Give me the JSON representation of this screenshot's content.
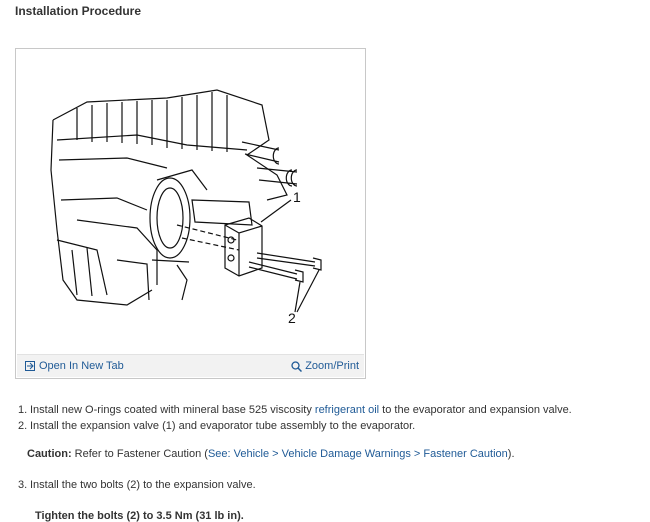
{
  "heading": "Installation Procedure",
  "figure": {
    "callout_1": "1",
    "callout_2": "2",
    "open_tab_label": "Open In New Tab",
    "zoom_label": "Zoom/Print"
  },
  "steps": [
    {
      "num": "1.",
      "pre": "Install new O-rings coated with mineral base 525 viscosity ",
      "link": "refrigerant oil",
      "post": " to the evaporator and expansion valve."
    },
    {
      "num": "2.",
      "text": "Install the expansion valve (1) and evaporator tube assembly to the evaporator."
    }
  ],
  "caution": {
    "label": "Caution:",
    "text": " Refer to Fastener Caution (",
    "link": "See: Vehicle > Vehicle Damage Warnings > Fastener Caution",
    "post": ")."
  },
  "step3": {
    "num": "3.",
    "text": "Install the two bolts (2) to the expansion valve."
  },
  "torque": "Tighten the bolts (2) to 3.5 Nm (31 lb in).",
  "colors": {
    "link": "#1f5a96",
    "text": "#333333",
    "footer_bg": "#f2f2f2"
  }
}
